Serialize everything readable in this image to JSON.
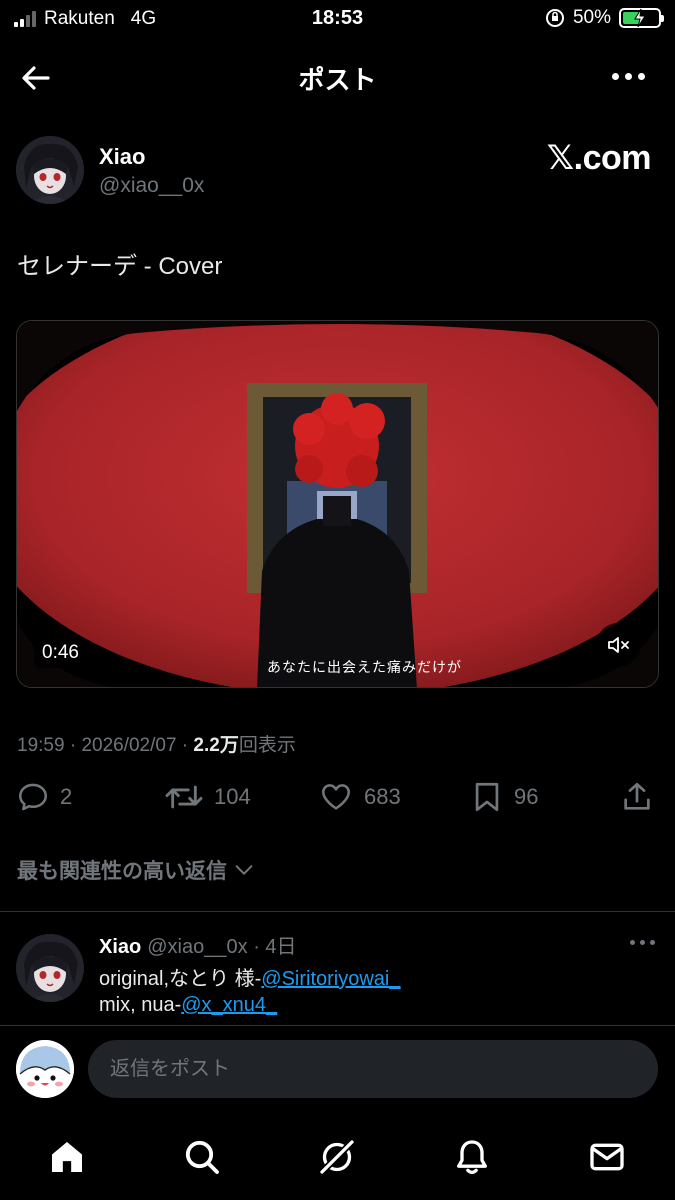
{
  "status_bar": {
    "carrier": "Rakuten",
    "network": "4G",
    "time": "18:53",
    "battery_percent": "50%",
    "battery_level": 0.5,
    "icons": [
      "signal-icon",
      "orientation-lock-icon",
      "battery-charging-icon"
    ]
  },
  "header": {
    "title": "ポスト",
    "back_icon": "arrow-left-icon",
    "more_icon": "more-horizontal-icon"
  },
  "post": {
    "author_name": "Xiao",
    "author_handle": "@xiao__0x",
    "watermark": "𝕏.com",
    "text": "セレナーデ - Cover",
    "video": {
      "duration": "0:46",
      "subtitle": "あなたに出会えた痛みだけが",
      "mute_icon": "speaker-muted-icon"
    },
    "time": "19:59",
    "date": "2026/02/07",
    "views_count": "2.2万",
    "views_label": "回表示",
    "separator": " · "
  },
  "actions": {
    "replies": "2",
    "reposts": "104",
    "likes": "683",
    "bookmarks": "96",
    "icons": [
      "reply-icon",
      "repost-icon",
      "like-icon",
      "bookmark-icon",
      "share-icon"
    ]
  },
  "sort_label": "最も関連性の高い返信",
  "reply": {
    "name": "Xiao",
    "handle": "@xiao__0x",
    "age": "· 4日",
    "line1_text": "original,なとり 様-",
    "line1_mention": "@Siritoriyowai_",
    "line2_text": "mix, nua-",
    "line2_mention": "@x_xnu4_"
  },
  "composer": {
    "placeholder": "返信をポスト"
  },
  "tabbar": {
    "items": [
      "home-icon",
      "search-icon",
      "grok-icon",
      "notifications-icon",
      "messages-icon"
    ]
  },
  "colors": {
    "background": "#000000",
    "text": "#e7e9ea",
    "muted": "#71767b",
    "link": "#1d9bf0",
    "video_red": "#b3272b"
  }
}
